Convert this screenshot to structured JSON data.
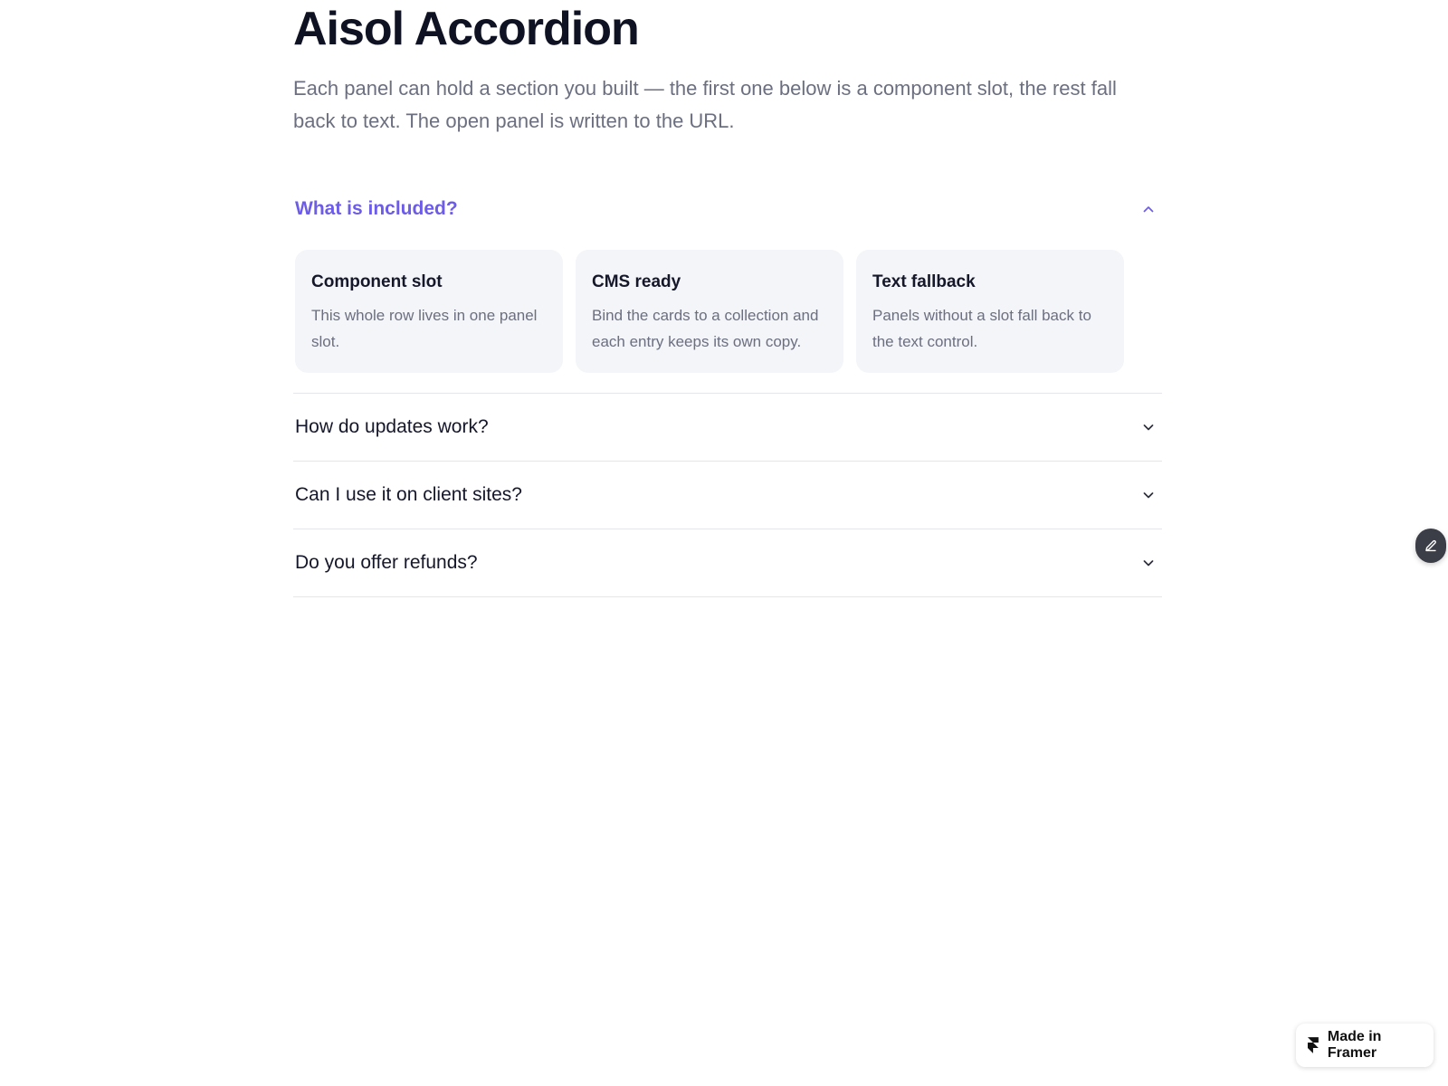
{
  "page": {
    "title": "Aisol Accordion",
    "subtitle": "Each panel can hold a section you built — the first one below is a component slot, the rest fall back to text. The open panel is written to the URL."
  },
  "accordion": {
    "accent_color": "#6c5ce7",
    "items": [
      {
        "question": "What is included?",
        "open": true,
        "icon": "chevron-up-icon",
        "cards": [
          {
            "title": "Component slot",
            "description": "This whole row lives in one panel slot."
          },
          {
            "title": "CMS ready",
            "description": "Bind the cards to a collection and each entry keeps its own copy."
          },
          {
            "title": "Text fallback",
            "description": "Panels without a slot fall back to the text control."
          }
        ]
      },
      {
        "question": "How do updates work?",
        "open": false,
        "icon": "chevron-down-icon"
      },
      {
        "question": "Can I use it on client sites?",
        "open": false,
        "icon": "chevron-down-icon"
      },
      {
        "question": "Do you offer refunds?",
        "open": false,
        "icon": "chevron-down-icon"
      }
    ]
  },
  "floating": {
    "edit_icon": "pencil-icon",
    "badge_label": "Made in Framer",
    "badge_icon": "framer-logo-icon"
  }
}
